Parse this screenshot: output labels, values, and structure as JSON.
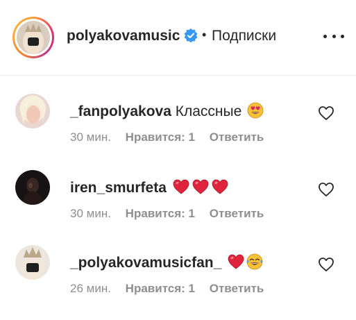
{
  "header": {
    "username": "polyakovamusic",
    "separator": "•",
    "follow_label": "Подписки",
    "icons": {
      "verified": "verified-badge-icon",
      "more": "more-horizontal-icon"
    },
    "colors": {
      "verified": "#3897f0"
    }
  },
  "comments": [
    {
      "username": "_fanpolyakova",
      "text": "Классные",
      "emojis": [
        "heart-eyes-emoji"
      ],
      "time": "30 мин.",
      "likes": "Нравится: 1",
      "reply": "Ответить"
    },
    {
      "username": "iren_smurfeta",
      "text": "",
      "emojis": [
        "red-heart-emoji",
        "red-heart-emoji",
        "red-heart-emoji"
      ],
      "time": "30 мин.",
      "likes": "Нравится: 1",
      "reply": "Ответить"
    },
    {
      "username": "_polyakovamusicfan_",
      "text": "",
      "emojis": [
        "red-heart-emoji",
        "tears-of-joy-emoji"
      ],
      "time": "26 мин.",
      "likes": "Нравится: 1",
      "reply": "Ответить"
    }
  ]
}
